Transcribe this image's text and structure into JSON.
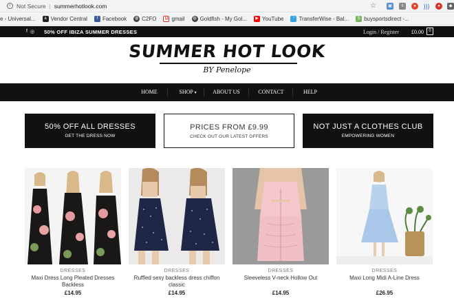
{
  "browser": {
    "security_label": "Not Secure",
    "url": "summerhotlook.com",
    "bookmarks": [
      {
        "label": "e - Universal...",
        "icon": "page-icon",
        "color": "#bbbbbb"
      },
      {
        "label": "Vendor Central",
        "icon": "amazon-icon",
        "color": "#222222"
      },
      {
        "label": "Facebook",
        "icon": "facebook-icon",
        "color": "#3b5998"
      },
      {
        "label": "C2FO",
        "icon": "globe-icon",
        "color": "#444444"
      },
      {
        "label": "gmail",
        "icon": "gmail-icon",
        "color": "#d93025"
      },
      {
        "label": "Goldfish - My Gol...",
        "icon": "globe-icon",
        "color": "#444444"
      },
      {
        "label": "YouTube",
        "icon": "youtube-icon",
        "color": "#ff0000"
      },
      {
        "label": "TransferWise - Bal...",
        "icon": "transferwise-icon",
        "color": "#37a1e6"
      },
      {
        "label": "buysportsdirect -...",
        "icon": "shopify-icon",
        "color": "#7ab55c"
      }
    ]
  },
  "topbar": {
    "promo": "50% OFF IBIZA SUMMER DRESSES",
    "login": "Login / Register",
    "cart_amount": "£0.00",
    "cart_count": "0"
  },
  "logo": {
    "title": "SUMMER HOT LOOK",
    "subtitle": "BY Penelope"
  },
  "nav": {
    "items": [
      "HOME",
      "SHOP",
      "ABOUT US",
      "CONTACT",
      "HELP"
    ]
  },
  "banners": [
    {
      "title": "50% OFF ALL DRESSES",
      "subtitle": "GET THE DRESS NOW"
    },
    {
      "title": "PRICES FROM £9.99",
      "subtitle": "CHECK OUT OUR LATEST OFFERS"
    },
    {
      "title": "NOT JUST A CLOTHES CLUB",
      "subtitle": "EMPOWERING WOMEN"
    }
  ],
  "products": [
    {
      "category": "DRESSES",
      "name": "Maxi Dress Long Pleated Dresses Backless",
      "price": "£14.95"
    },
    {
      "category": "DRESSES",
      "name": "Ruffled sexy backless dress chiffon classic",
      "price": "£14.95"
    },
    {
      "category": "DRESSES",
      "name": "Sleeveless V-neck Hollow Out",
      "price": "£14.95"
    },
    {
      "category": "DRESSES",
      "name": "Maxi Long Midi A-Line Dress",
      "price": "£26.95"
    }
  ]
}
